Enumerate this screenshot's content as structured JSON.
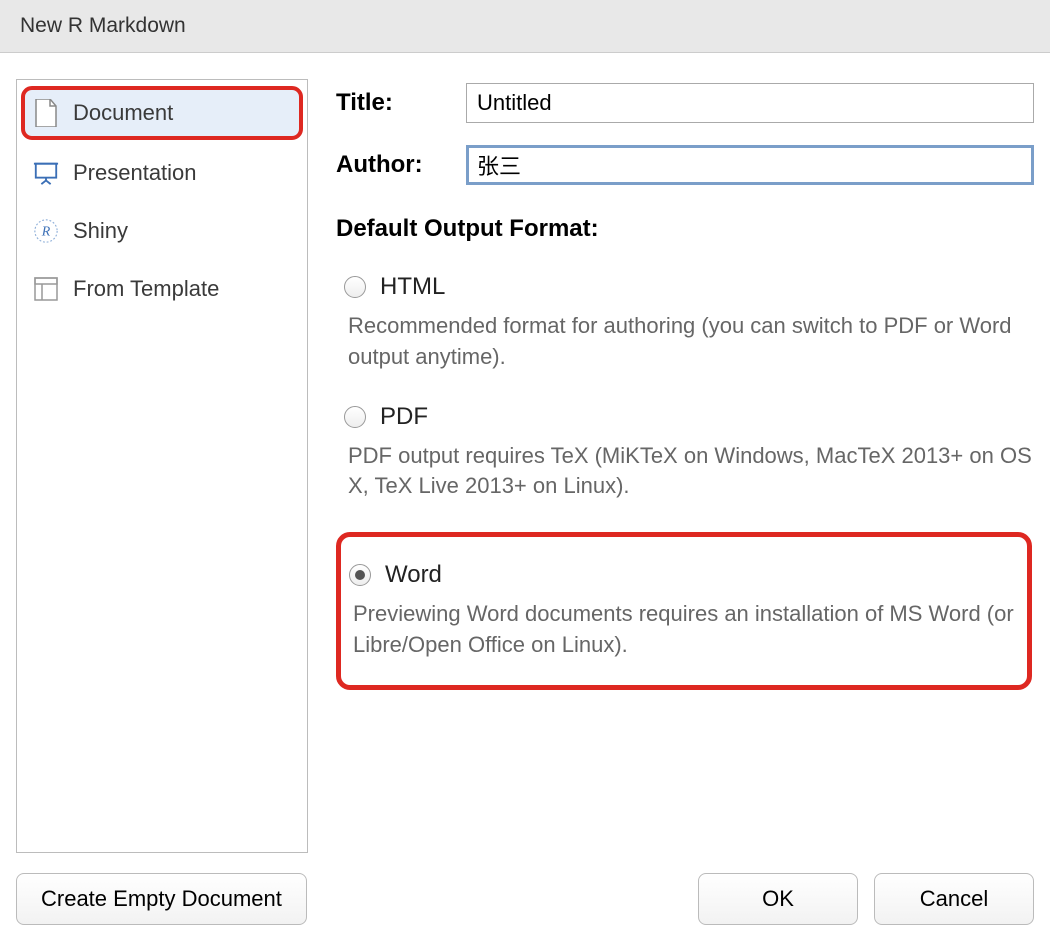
{
  "window": {
    "title": "New R Markdown"
  },
  "sidebar": {
    "items": [
      {
        "label": "Document",
        "selected": true
      },
      {
        "label": "Presentation",
        "selected": false
      },
      {
        "label": "Shiny",
        "selected": false
      },
      {
        "label": "From Template",
        "selected": false
      }
    ]
  },
  "form": {
    "title_label": "Title:",
    "title_value": "Untitled",
    "author_label": "Author:",
    "author_value": "张三"
  },
  "output": {
    "heading": "Default Output Format:",
    "options": [
      {
        "label": "HTML",
        "desc": "Recommended format for authoring (you can switch to PDF or Word output anytime).",
        "checked": false
      },
      {
        "label": "PDF",
        "desc": "PDF output requires TeX (MiKTeX on Windows, MacTeX 2013+ on OS X, TeX Live 2013+ on Linux).",
        "checked": false
      },
      {
        "label": "Word",
        "desc": "Previewing Word documents requires an installation of MS Word (or Libre/Open Office on Linux).",
        "checked": true
      }
    ]
  },
  "buttons": {
    "create_empty": "Create Empty Document",
    "ok": "OK",
    "cancel": "Cancel"
  }
}
